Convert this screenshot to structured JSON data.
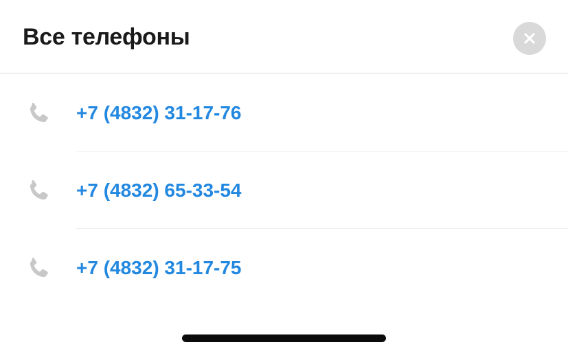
{
  "header": {
    "title": "Все телефоны",
    "close_icon": "close-icon"
  },
  "phones": [
    {
      "icon": "phone-icon",
      "number": "+7 (4832) 31-17-76"
    },
    {
      "icon": "phone-icon",
      "number": "+7 (4832) 65-33-54"
    },
    {
      "icon": "phone-icon",
      "number": "+7 (4832) 31-17-75"
    }
  ],
  "colors": {
    "link": "#2288e0",
    "title": "#1a1a1a",
    "icon": "#c8c8c8",
    "close_bg": "#d9d9d9",
    "divider": "#ececec"
  }
}
